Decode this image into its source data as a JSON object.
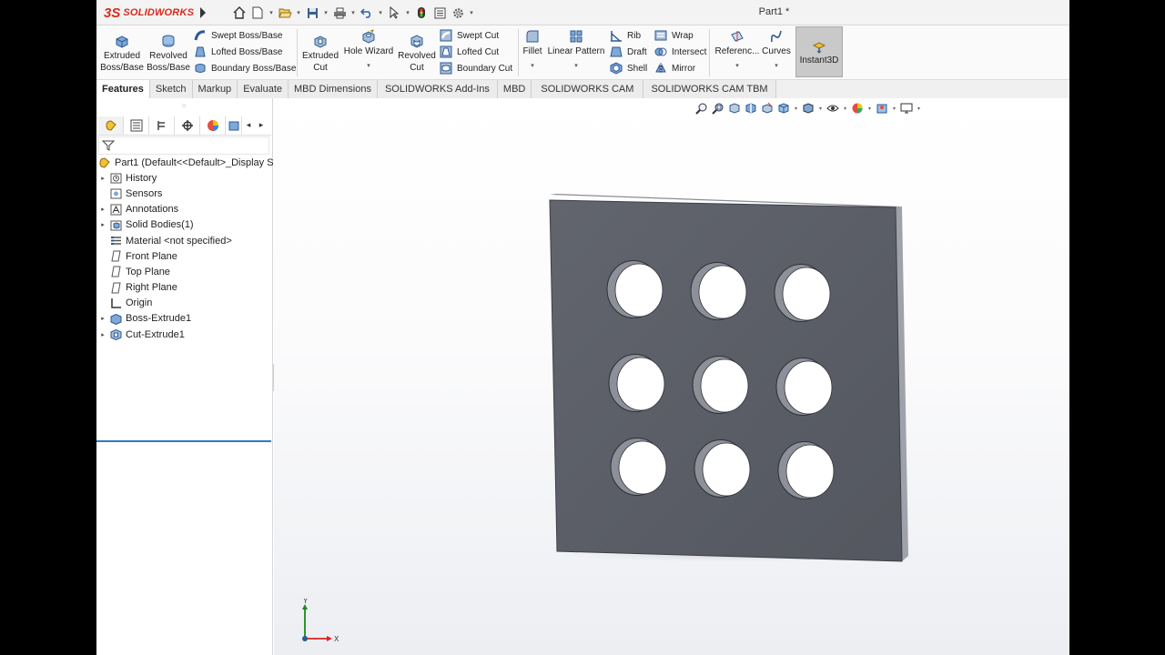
{
  "app": {
    "logo_mark": "3S",
    "logo_text": "SOLIDWORKS",
    "document_title": "Part1 *"
  },
  "quick_access": [
    "home-icon",
    "new-document-icon",
    "open-icon",
    "save-icon",
    "print-icon",
    "undo-icon",
    "select-icon",
    "rebuild-icon",
    "file-properties-icon",
    "options-icon"
  ],
  "ribbon": {
    "extruded_boss": "Extruded\nBoss/Base",
    "revolved_boss": "Revolved\nBoss/Base",
    "swept_boss": "Swept Boss/Base",
    "lofted_boss": "Lofted Boss/Base",
    "boundary_boss": "Boundary Boss/Base",
    "extruded_cut": "Extruded\nCut",
    "hole_wizard": "Hole Wizard",
    "revolved_cut": "Revolved\nCut",
    "swept_cut": "Swept Cut",
    "lofted_cut": "Lofted Cut",
    "boundary_cut": "Boundary Cut",
    "fillet": "Fillet",
    "linear_pattern": "Linear Pattern",
    "rib": "Rib",
    "draft": "Draft",
    "shell": "Shell",
    "wrap": "Wrap",
    "intersect": "Intersect",
    "mirror": "Mirror",
    "reference": "Referenc...",
    "curves": "Curves",
    "instant3d": "Instant3D"
  },
  "command_tabs": [
    {
      "label": "Features",
      "active": true
    },
    {
      "label": "Sketch",
      "active": false
    },
    {
      "label": "Markup",
      "active": false
    },
    {
      "label": "Evaluate",
      "active": false
    },
    {
      "label": "MBD Dimensions",
      "active": false
    },
    {
      "label": "SOLIDWORKS Add-Ins",
      "active": false
    },
    {
      "label": "MBD",
      "active": false
    },
    {
      "label": "SOLIDWORKS CAM",
      "active": false
    },
    {
      "label": "SOLIDWORKS CAM TBM",
      "active": false
    }
  ],
  "feature_manager": {
    "tabs": [
      "featuremanager-tab-icon",
      "propertymanager-tab-icon",
      "configurationmanager-tab-icon",
      "dimxpertmanager-tab-icon",
      "displaymanager-tab-icon",
      "cam-tab-icon"
    ],
    "tree": [
      {
        "label": "Part1  (Default<<Default>_Display S",
        "icon": "part-icon",
        "expandable": false
      },
      {
        "label": "History",
        "icon": "history-icon",
        "expandable": true
      },
      {
        "label": "Sensors",
        "icon": "sensors-icon",
        "expandable": false
      },
      {
        "label": "Annotations",
        "icon": "annotations-icon",
        "expandable": true
      },
      {
        "label": "Solid Bodies(1)",
        "icon": "solid-bodies-icon",
        "expandable": true
      },
      {
        "label": "Material <not specified>",
        "icon": "material-icon",
        "expandable": false
      },
      {
        "label": "Front Plane",
        "icon": "plane-icon",
        "expandable": false
      },
      {
        "label": "Top Plane",
        "icon": "plane-icon",
        "expandable": false
      },
      {
        "label": "Right Plane",
        "icon": "plane-icon",
        "expandable": false
      },
      {
        "label": "Origin",
        "icon": "origin-icon",
        "expandable": false
      },
      {
        "label": "Boss-Extrude1",
        "icon": "extrude-icon",
        "expandable": true
      },
      {
        "label": "Cut-Extrude1",
        "icon": "cut-extrude-icon",
        "expandable": true
      }
    ]
  },
  "view_toolbar": [
    "zoom-to-fit-icon",
    "zoom-to-area-icon",
    "previous-view-icon",
    "section-view-icon",
    "dynamic-annotation-icon",
    "view-orientation-icon",
    "display-style-icon",
    "hide-show-items-icon",
    "edit-appearance-icon",
    "apply-scene-icon",
    "view-settings-icon"
  ],
  "model": {
    "holes_rows": 3,
    "holes_cols": 3,
    "body_color": "#5a5d66"
  },
  "triad": {
    "x_label": "X",
    "y_label": "Y"
  },
  "colors": {
    "accent": "#2f7bbf",
    "logo_red": "#d52b1e",
    "active_tab_bg": "#ffffff"
  }
}
